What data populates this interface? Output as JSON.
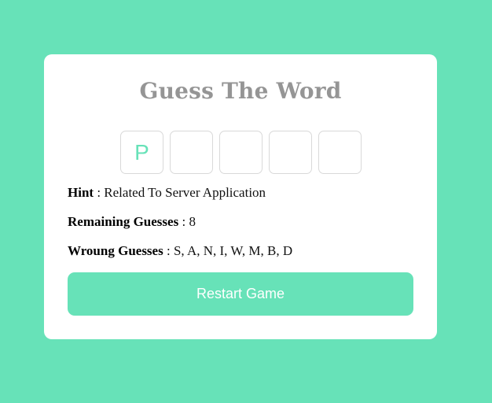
{
  "game": {
    "title": "Guess The Word",
    "letters": [
      "P",
      "",
      "",
      "",
      ""
    ],
    "hint_label": "Hint",
    "hint_value": "Related To Server Application",
    "remaining_label": "Remaining Guesses",
    "remaining_value": "8",
    "wrong_label": "Wroung Guesses",
    "wrong_value": "S, A, N, I, W, M, B, D",
    "separator": " : ",
    "restart_label": "Restart Game"
  },
  "colors": {
    "background": "#67e2b8",
    "card": "#ffffff",
    "title": "#959595",
    "accent": "#67e2b8"
  }
}
